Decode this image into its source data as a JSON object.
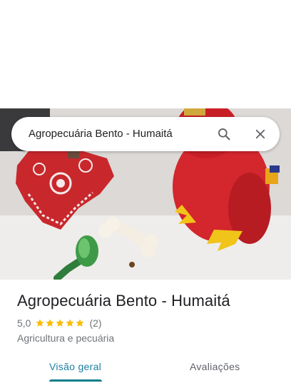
{
  "search": {
    "query": "Agropecuária Bento - Humaitá"
  },
  "icons": {
    "search": "search-icon",
    "close": "close-icon",
    "star": "star-icon"
  },
  "place": {
    "title": "Agropecuária Bento - Humaitá",
    "rating": "5,0",
    "stars": 5,
    "review_count": "(2)",
    "category": "Agricultura e pecuária"
  },
  "tabs": {
    "overview": "Visão geral",
    "reviews": "Avaliações",
    "selected": "overview"
  },
  "colors": {
    "accent": "#0b7f8a",
    "star": "#fbbc04",
    "text_primary": "#202124",
    "text_secondary": "#70757a"
  }
}
